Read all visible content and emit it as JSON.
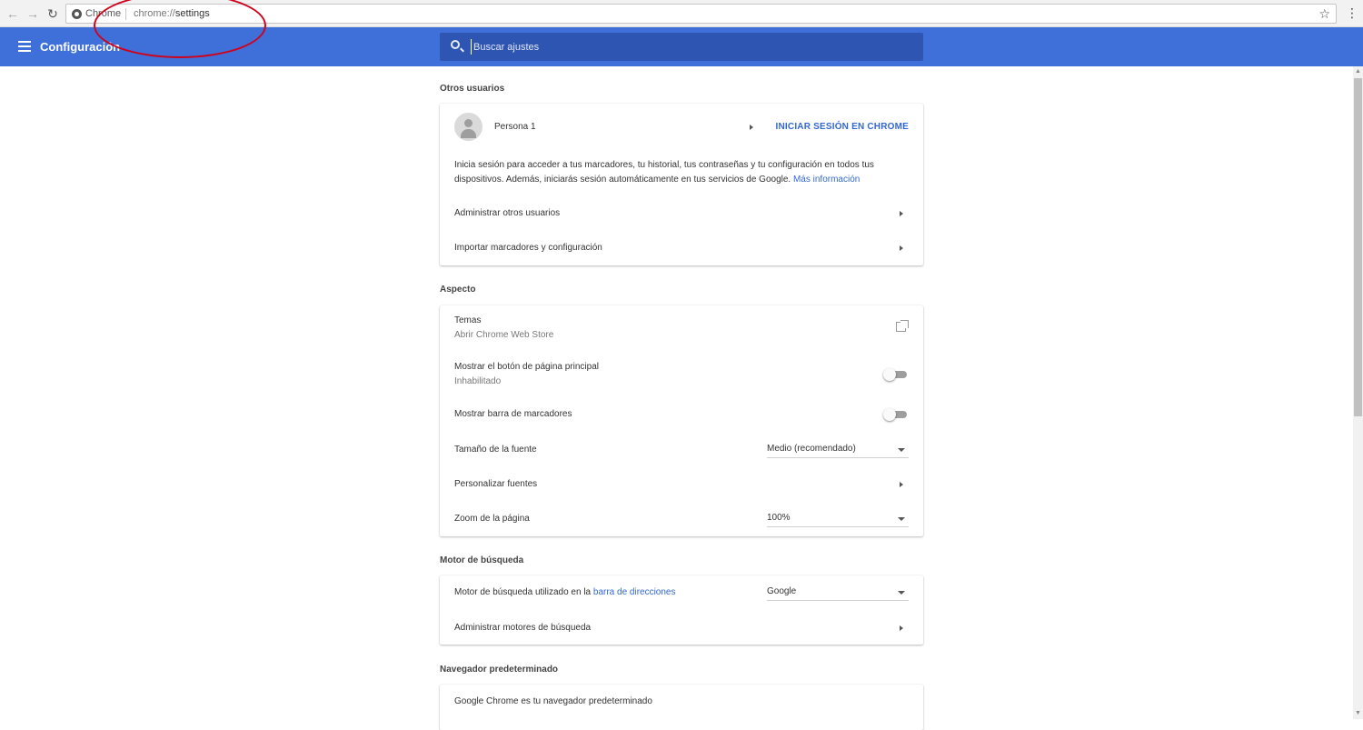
{
  "browser": {
    "site_label": "Chrome",
    "url_scheme": "chrome://",
    "url_path": "settings",
    "star_glyph": "☆",
    "menu_glyph": "⋮"
  },
  "header": {
    "title": "Configuración",
    "search_placeholder": "Buscar ajustes",
    "color": "#3f6fd8"
  },
  "sections": {
    "people": {
      "title": "Otros usuarios",
      "person_name": "Persona 1",
      "signin_label": "INICIAR SESIÓN EN CHROME",
      "description": "Inicia sesión para acceder a tus marcadores, tu historial, tus contraseñas y tu configuración en todos tus dispositivos. Además, iniciarás sesión automáticamente en tus servicios de Google.",
      "more_info": "Más información",
      "manage_users": "Administrar otros usuarios",
      "import": "Importar marcadores y configuración"
    },
    "appearance": {
      "title": "Aspecto",
      "themes": "Temas",
      "themes_sub": "Abrir Chrome Web Store",
      "home_button": "Mostrar el botón de página principal",
      "home_button_sub": "Inhabilitado",
      "bookmarks_bar": "Mostrar barra de marcadores",
      "font_size_label": "Tamaño de la fuente",
      "font_size_value": "Medio (recomendado)",
      "custom_fonts": "Personalizar fuentes",
      "zoom_label": "Zoom de la página",
      "zoom_value": "100%"
    },
    "search": {
      "title": "Motor de búsqueda",
      "engine_label_prefix": "Motor de búsqueda utilizado en la",
      "engine_label_link": "barra de direcciones",
      "engine_value": "Google",
      "manage_engines": "Administrar motores de búsqueda"
    },
    "default_browser": {
      "title": "Navegador predeterminado",
      "status": "Google Chrome es tu navegador predeterminado"
    }
  }
}
